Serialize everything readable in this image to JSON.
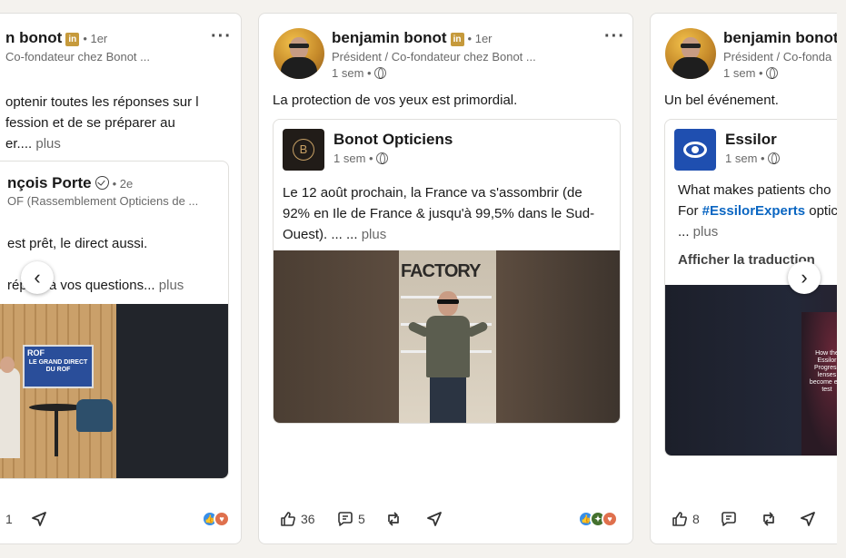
{
  "left_post": {
    "author": "n bonot",
    "degree": "• 1er",
    "subtitle": "Co-fondateur chez Bonot ...",
    "text_lines": [
      "optenir toutes les réponses sur l",
      "fession et de se préparer au",
      "er.... "
    ],
    "more": "plus",
    "inner": {
      "author": "nçois Porte",
      "degree": "• 2e",
      "subtitle": "OF (Rassemblement Opticiens de ...",
      "text_line1": "est prêt, le direct aussi.",
      "text_line2": "répo   s à vos questions... ",
      "more": "plus",
      "screen_logo": "ROF",
      "screen_title": "LE GRAND DIRECT DU ROF"
    },
    "actions": {
      "comments": "1"
    }
  },
  "mid_post": {
    "author": "benjamin bonot",
    "badge": "in",
    "degree": "• 1er",
    "subtitle": "Président / Co-fondateur chez Bonot ...",
    "time": "1 sem •",
    "text": "La protection de vos yeux est primordial.",
    "inner": {
      "logo_letter": "B",
      "author": "Bonot Opticiens",
      "time": "1 sem •",
      "text_line1": "Le 12 août prochain, la France va s'assombrir (de",
      "text_line2": "92% en Ile de France & jusqu'à 99,5% dans le Sud-",
      "text_line3": "Ouest). ...     ... ",
      "more": "plus",
      "store_sign": "FACTORY"
    },
    "actions": {
      "likes": "36",
      "comments": "5"
    }
  },
  "right_post": {
    "author": "benjamin bonot",
    "subtitle": "Président / Co-fonda",
    "time": "1 sem •",
    "text": "Un bel événement.",
    "inner": {
      "author": "Essilor",
      "time": "1 sem •",
      "text_line1": "What makes patients cho",
      "text_line2_pre": "For ",
      "hashtag": "#EssilorExperts",
      "text_line2_post": " optic",
      "text_line3": "... ",
      "more": "plus",
      "translate": "Afficher la traduction",
      "video_caption": "How the Essilor Progress lenses become eye test"
    },
    "actions": {
      "likes": "8"
    }
  },
  "carousel": {
    "prev": "‹",
    "next": "›"
  },
  "colors": {
    "accent_blue": "#0a66c2",
    "bonot_gold": "#c69a3c",
    "essilor_blue": "#1f4fb0"
  }
}
